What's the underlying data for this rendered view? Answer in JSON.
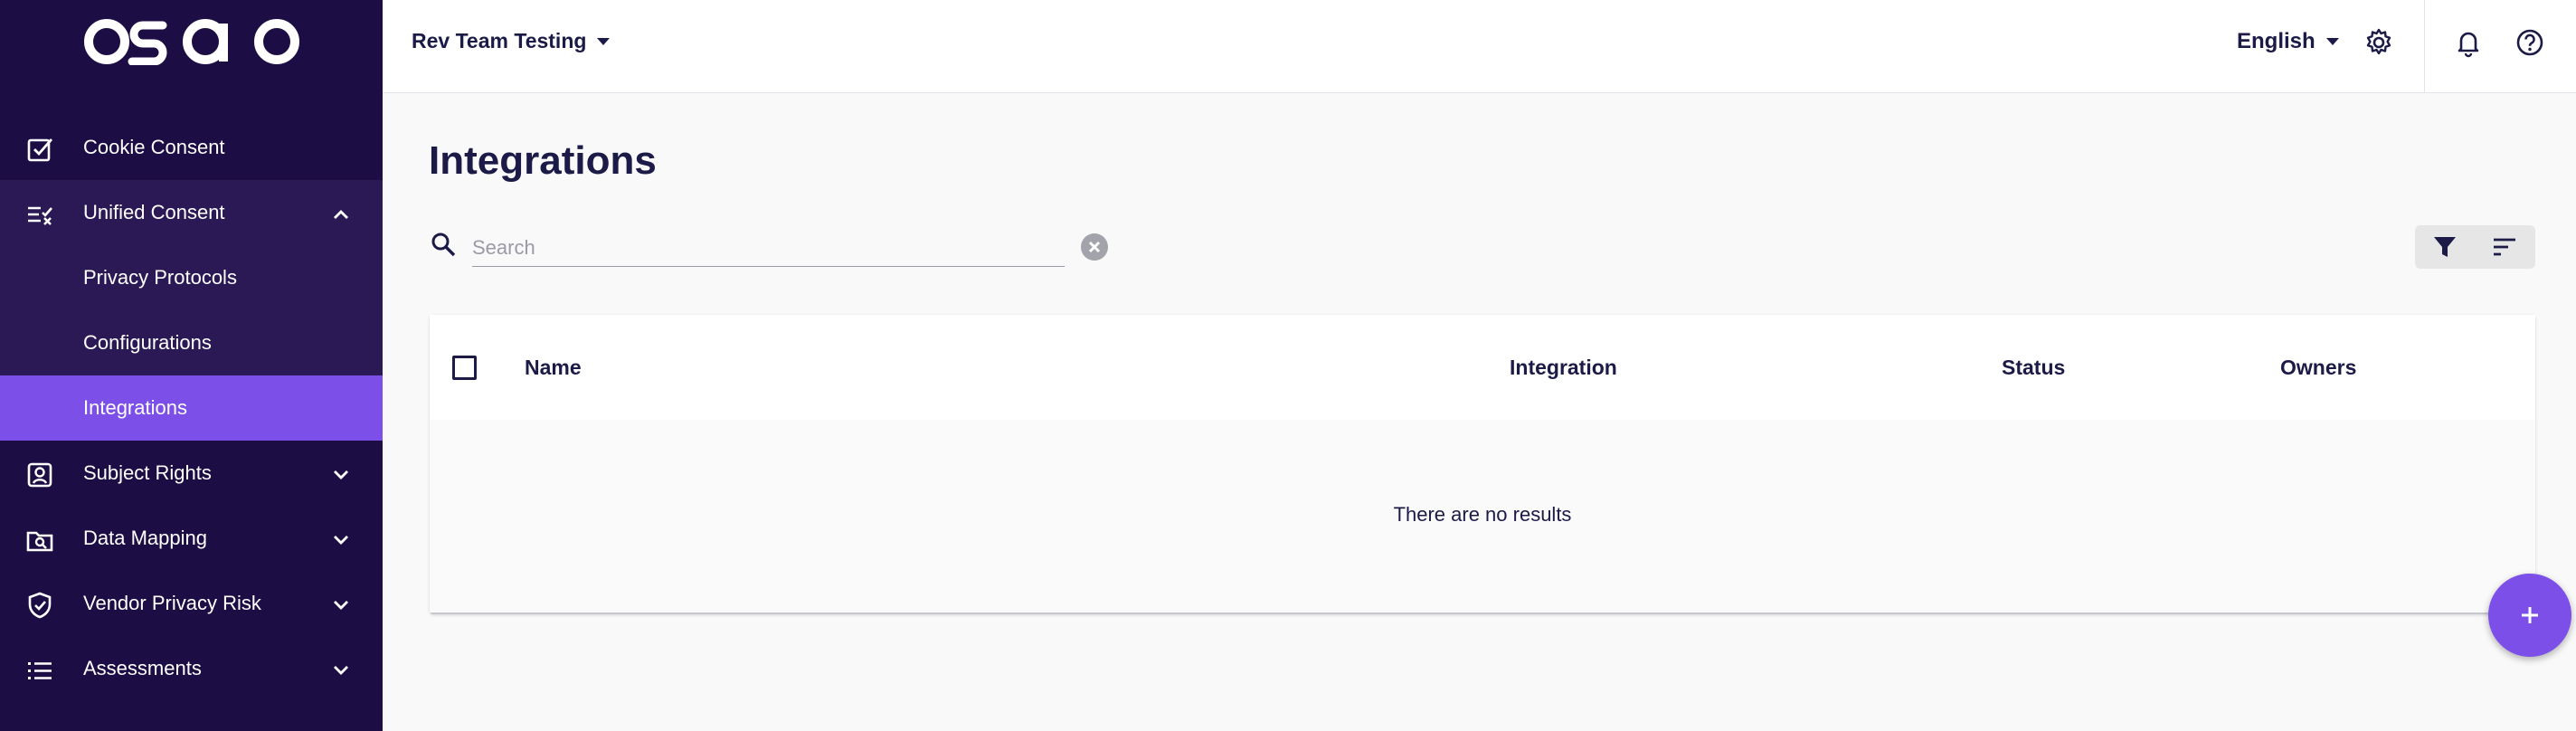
{
  "app": {
    "logo_text": "osano"
  },
  "sidebar": {
    "items": [
      {
        "label": "Cookie Consent",
        "icon": "checkbox-icon"
      },
      {
        "label": "Unified Consent",
        "icon": "consent-list-icon",
        "expanded": true,
        "children": [
          {
            "label": "Privacy Protocols"
          },
          {
            "label": "Configurations"
          },
          {
            "label": "Integrations",
            "active": true
          }
        ]
      },
      {
        "label": "Subject Rights",
        "icon": "account-box-icon"
      },
      {
        "label": "Data Mapping",
        "icon": "folder-search-icon"
      },
      {
        "label": "Vendor Privacy Risk",
        "icon": "shield-check-icon"
      },
      {
        "label": "Assessments",
        "icon": "list-icon"
      }
    ]
  },
  "topbar": {
    "org": "Rev Team Testing",
    "language": "English",
    "icons": [
      "gear-icon",
      "bell-icon",
      "help-icon"
    ]
  },
  "main": {
    "title": "Integrations",
    "search": {
      "placeholder": "Search",
      "value": ""
    },
    "table": {
      "columns": [
        "Name",
        "Integration",
        "Status",
        "Owners"
      ],
      "rows": [],
      "empty_message": "There are no results"
    }
  },
  "colors": {
    "sidebar_bg": "#1c0d44",
    "sidebar_sub_bg": "#2b1956",
    "accent": "#7b4fe8",
    "text_dark": "#1c1a47"
  }
}
